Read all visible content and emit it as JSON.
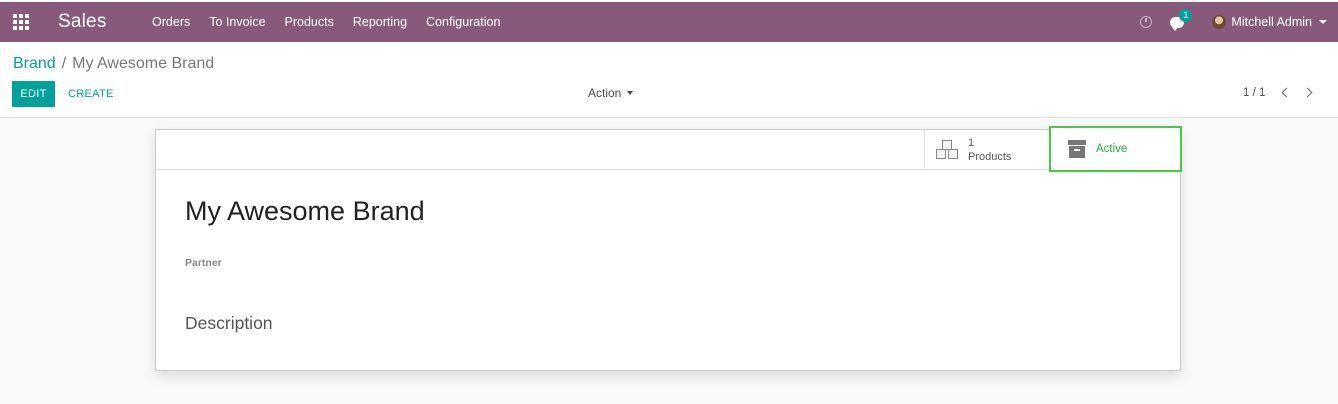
{
  "navbar": {
    "app_name": "Sales",
    "menu": [
      "Orders",
      "To Invoice",
      "Products",
      "Reporting",
      "Configuration"
    ],
    "chat_badge": "1",
    "user_name": "Mitchell Admin",
    "color": "#875a7b"
  },
  "breadcrumb": {
    "parent": "Brand",
    "separator": "/",
    "current": "My Awesome Brand"
  },
  "toolbar": {
    "edit_label": "EDIT",
    "create_label": "CREATE",
    "action_label": "Action",
    "pager": "1 / 1"
  },
  "stat_buttons": {
    "products_count": "1",
    "products_label": "Products",
    "active_label": "Active"
  },
  "form": {
    "title": "My Awesome Brand",
    "partner_label": "Partner",
    "description_label": "Description"
  },
  "colors": {
    "accent": "#00a09d",
    "active": "#28a745",
    "highlight_border": "#44cc44"
  }
}
